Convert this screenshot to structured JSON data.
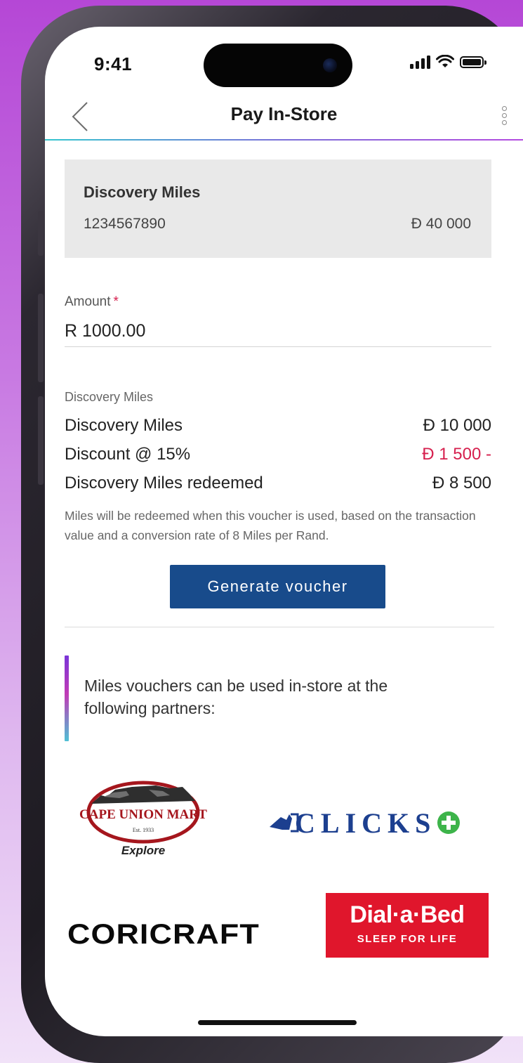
{
  "status_bar": {
    "time": "9:41"
  },
  "header": {
    "title": "Pay In-Store"
  },
  "account": {
    "name": "Discovery Miles",
    "number": "1234567890",
    "balance": "Đ 40 000"
  },
  "amount": {
    "label": "Amount",
    "required_mark": "*",
    "value": "R 1000.00"
  },
  "summary": {
    "caption": "Discovery Miles",
    "rows": [
      {
        "label": "Discovery Miles",
        "value": "Đ 10 000"
      },
      {
        "label": "Discount @ 15%",
        "value": "Đ 1 500 -"
      },
      {
        "label": "Discovery Miles redeemed",
        "value": "Đ 8 500"
      }
    ],
    "disclaimer": "Miles will be redeemed when this voucher is used, based on the transaction value and a conversion rate of 8 Miles per Rand."
  },
  "actions": {
    "generate_label": "Generate voucher"
  },
  "partners": {
    "intro": "Miles vouchers can be used in-store at the following partners:",
    "cape_union_mart": {
      "name": "CAPE UNION MART",
      "est": "Est. 1933",
      "tagline": "Explore"
    },
    "clicks": {
      "name": "CLICKS"
    },
    "coricraft": {
      "name": "CORICRAFT"
    },
    "dial_a_bed": {
      "name": "Dial·a·Bed",
      "tagline": "SLEEP FOR LIFE"
    }
  },
  "colors": {
    "primary_button": "#184b8b",
    "negative": "#d6204e",
    "accent_gradient": [
      "#35c6cf",
      "#7b6fd9",
      "#b44be0"
    ]
  },
  "icons": {
    "back": "chevron-left-icon",
    "more": "more-vertical-icon",
    "signal": "signal-icon",
    "wifi": "wifi-icon",
    "battery": "battery-icon"
  }
}
